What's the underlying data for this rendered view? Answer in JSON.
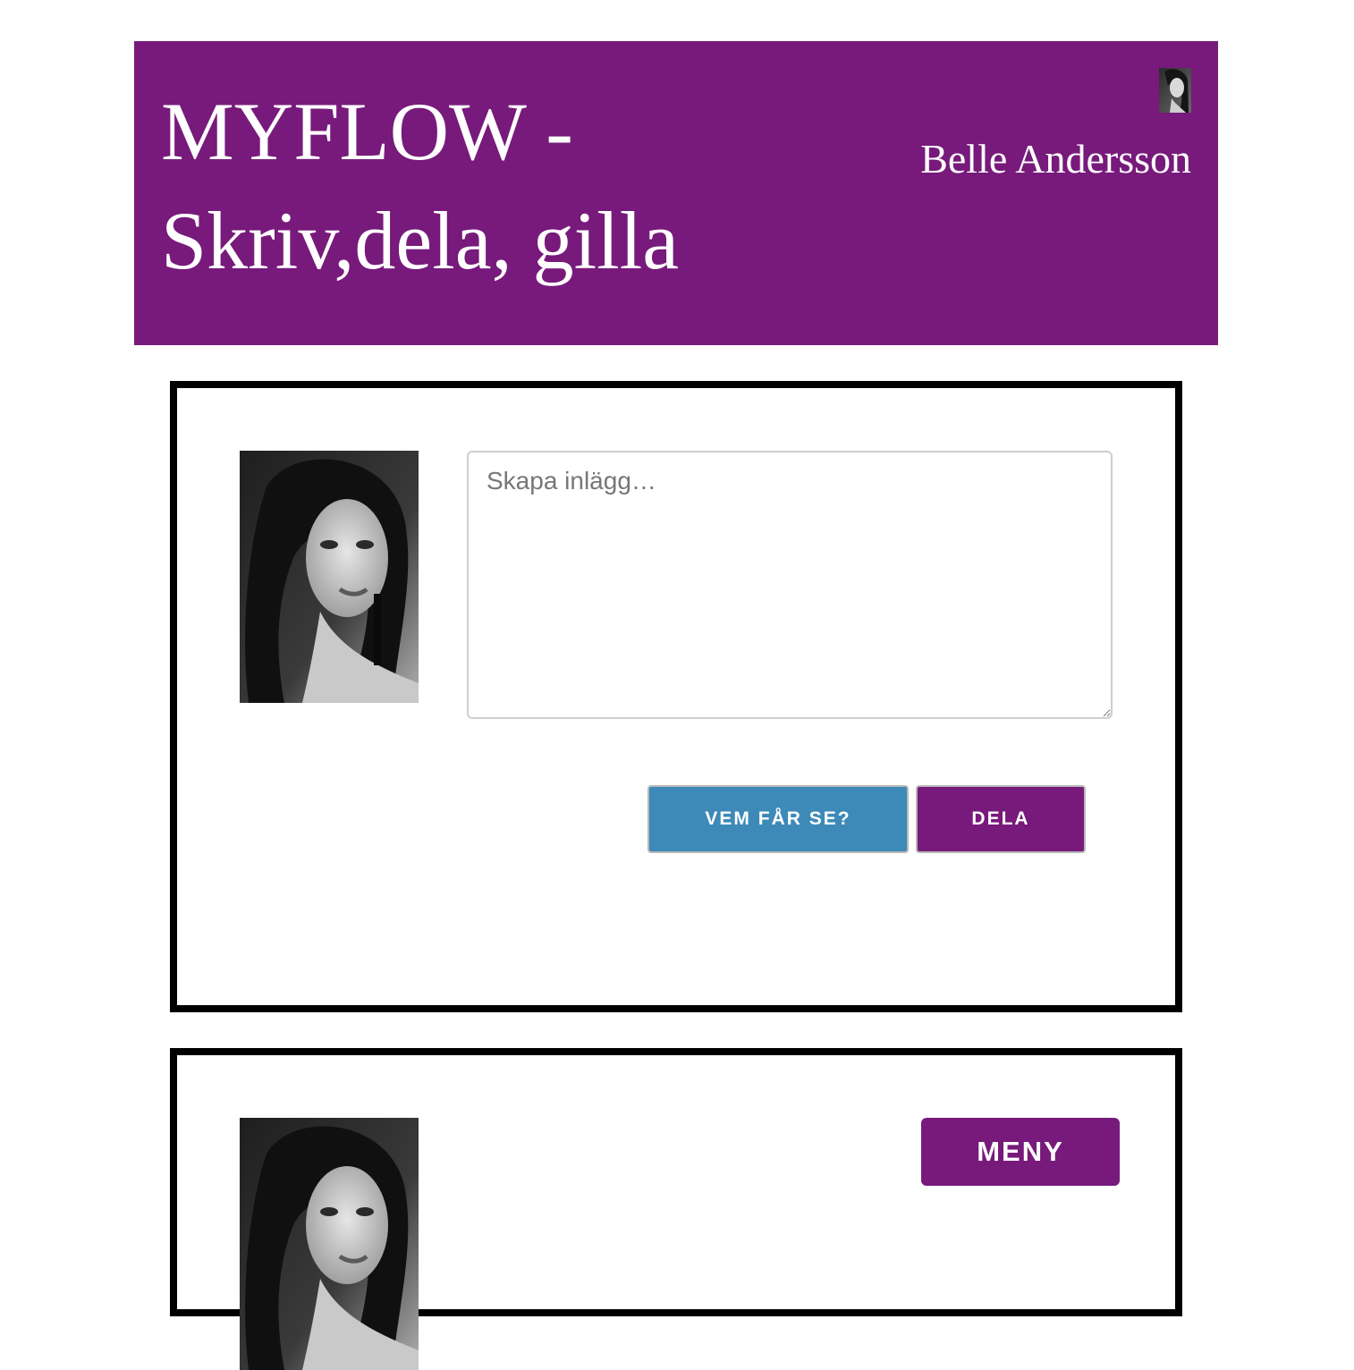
{
  "header": {
    "title": "MYFLOW - Skriv,dela, gilla",
    "username": "Belle Andersson",
    "avatar_icon": "user-avatar-photo"
  },
  "composer": {
    "placeholder": "Skapa inlägg…",
    "visibility_button": "VEM FÅR SE?",
    "share_button": "DELA"
  },
  "post": {
    "menu_button": "MENY"
  },
  "colors": {
    "brand_purple": "#771a7b",
    "visibility_blue": "#3d8ab8",
    "card_border": "#000000"
  }
}
